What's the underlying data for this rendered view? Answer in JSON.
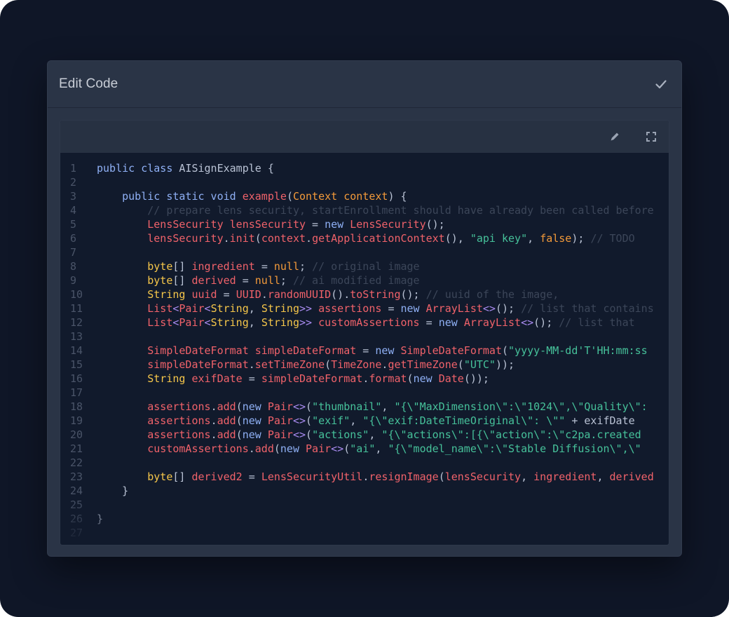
{
  "modal": {
    "title": "Edit Code",
    "confirm_icon": "check-icon"
  },
  "editor": {
    "toolbar": {
      "edit_icon": "pencil-icon",
      "fullscreen_icon": "expand-icon"
    },
    "colors": {
      "keyword": "#8fb0f5",
      "identifier": "#f0626a",
      "type": "#f5c64a",
      "literal": "#f39a3a",
      "string": "#46c19a",
      "comment": "#3c4659",
      "plain": "#b9c2d4"
    },
    "lines": [
      {
        "n": "1",
        "tokens": [
          [
            "kw",
            "public class "
          ],
          [
            "plain",
            "AISignExample {"
          ]
        ]
      },
      {
        "n": "2",
        "tokens": []
      },
      {
        "n": "3",
        "tokens": [
          [
            "kw",
            "    public static void "
          ],
          [
            "red",
            "example"
          ],
          [
            "plain",
            "("
          ],
          [
            "org",
            "Context context"
          ],
          [
            "plain",
            ") {"
          ]
        ]
      },
      {
        "n": "4",
        "tokens": [
          [
            "com",
            "        // prepare lens security, startEnrollment should have already been called before"
          ]
        ]
      },
      {
        "n": "5",
        "tokens": [
          [
            "red",
            "        LensSecurity lensSecurity "
          ],
          [
            "plain",
            "= "
          ],
          [
            "kw",
            "new "
          ],
          [
            "red",
            "LensSecurity"
          ],
          [
            "plain",
            "();"
          ]
        ]
      },
      {
        "n": "6",
        "tokens": [
          [
            "red",
            "        lensSecurity"
          ],
          [
            "plain",
            "."
          ],
          [
            "red",
            "init"
          ],
          [
            "plain",
            "("
          ],
          [
            "red",
            "context"
          ],
          [
            "plain",
            "."
          ],
          [
            "red",
            "getApplicationContext"
          ],
          [
            "plain",
            "(), "
          ],
          [
            "grn",
            "\"api key\""
          ],
          [
            "plain",
            ", "
          ],
          [
            "org",
            "false"
          ],
          [
            "plain",
            "); "
          ],
          [
            "com",
            "// TODO"
          ]
        ]
      },
      {
        "n": "7",
        "tokens": []
      },
      {
        "n": "8",
        "tokens": [
          [
            "yel",
            "        byte"
          ],
          [
            "plain",
            "[] "
          ],
          [
            "red",
            "ingredient "
          ],
          [
            "plain",
            "= "
          ],
          [
            "org",
            "null"
          ],
          [
            "plain",
            "; "
          ],
          [
            "com",
            "// original image"
          ]
        ]
      },
      {
        "n": "9",
        "tokens": [
          [
            "yel",
            "        byte"
          ],
          [
            "plain",
            "[] "
          ],
          [
            "red",
            "derived "
          ],
          [
            "plain",
            "= "
          ],
          [
            "org",
            "null"
          ],
          [
            "plain",
            "; "
          ],
          [
            "com",
            "// ai modified image"
          ]
        ]
      },
      {
        "n": "10",
        "tokens": [
          [
            "yel",
            "        String "
          ],
          [
            "red",
            "uuid "
          ],
          [
            "plain",
            "= "
          ],
          [
            "red",
            "UUID"
          ],
          [
            "plain",
            "."
          ],
          [
            "red",
            "randomUUID"
          ],
          [
            "plain",
            "()."
          ],
          [
            "red",
            "toString"
          ],
          [
            "plain",
            "(); "
          ],
          [
            "com",
            "// uuid of the image,"
          ]
        ]
      },
      {
        "n": "11",
        "tokens": [
          [
            "red",
            "        List"
          ],
          [
            "pur",
            "<"
          ],
          [
            "red",
            "Pair"
          ],
          [
            "pur",
            "<"
          ],
          [
            "yel",
            "String"
          ],
          [
            "plain",
            ", "
          ],
          [
            "yel",
            "String"
          ],
          [
            "pur",
            ">>"
          ],
          [
            "red",
            " assertions "
          ],
          [
            "plain",
            "= "
          ],
          [
            "kw",
            "new "
          ],
          [
            "red",
            "ArrayList"
          ],
          [
            "pur",
            "<>"
          ],
          [
            "plain",
            "(); "
          ],
          [
            "com",
            "// list that contains"
          ]
        ]
      },
      {
        "n": "12",
        "tokens": [
          [
            "red",
            "        List"
          ],
          [
            "pur",
            "<"
          ],
          [
            "red",
            "Pair"
          ],
          [
            "pur",
            "<"
          ],
          [
            "yel",
            "String"
          ],
          [
            "plain",
            ", "
          ],
          [
            "yel",
            "String"
          ],
          [
            "pur",
            ">>"
          ],
          [
            "red",
            " customAssertions "
          ],
          [
            "plain",
            "= "
          ],
          [
            "kw",
            "new "
          ],
          [
            "red",
            "ArrayList"
          ],
          [
            "pur",
            "<>"
          ],
          [
            "plain",
            "(); "
          ],
          [
            "com",
            "// list that"
          ]
        ]
      },
      {
        "n": "13",
        "tokens": []
      },
      {
        "n": "14",
        "tokens": [
          [
            "red",
            "        SimpleDateFormat simpleDateFormat "
          ],
          [
            "plain",
            "= "
          ],
          [
            "kw",
            "new "
          ],
          [
            "red",
            "SimpleDateFormat"
          ],
          [
            "plain",
            "("
          ],
          [
            "grn",
            "\"yyyy-MM-dd'T'HH:mm:ss"
          ]
        ]
      },
      {
        "n": "15",
        "tokens": [
          [
            "red",
            "        simpleDateFormat"
          ],
          [
            "plain",
            "."
          ],
          [
            "red",
            "setTimeZone"
          ],
          [
            "plain",
            "("
          ],
          [
            "red",
            "TimeZone"
          ],
          [
            "plain",
            "."
          ],
          [
            "red",
            "getTimeZone"
          ],
          [
            "plain",
            "("
          ],
          [
            "grn",
            "\"UTC\""
          ],
          [
            "plain",
            "));"
          ]
        ]
      },
      {
        "n": "16",
        "tokens": [
          [
            "yel",
            "        String "
          ],
          [
            "red",
            "exifDate "
          ],
          [
            "plain",
            "= "
          ],
          [
            "red",
            "simpleDateFormat"
          ],
          [
            "plain",
            "."
          ],
          [
            "red",
            "format"
          ],
          [
            "plain",
            "("
          ],
          [
            "kw",
            "new "
          ],
          [
            "red",
            "Date"
          ],
          [
            "plain",
            "());"
          ]
        ]
      },
      {
        "n": "17",
        "tokens": []
      },
      {
        "n": "18",
        "tokens": [
          [
            "red",
            "        assertions"
          ],
          [
            "plain",
            "."
          ],
          [
            "red",
            "add"
          ],
          [
            "plain",
            "("
          ],
          [
            "kw",
            "new "
          ],
          [
            "red",
            "Pair"
          ],
          [
            "pur",
            "<>"
          ],
          [
            "plain",
            "("
          ],
          [
            "grn",
            "\"thumbnail\""
          ],
          [
            "plain",
            ", "
          ],
          [
            "grn",
            "\"{\\\"MaxDimension\\\":\\\"1024\\\",\\\"Quality\\\":"
          ]
        ]
      },
      {
        "n": "19",
        "tokens": [
          [
            "red",
            "        assertions"
          ],
          [
            "plain",
            "."
          ],
          [
            "red",
            "add"
          ],
          [
            "plain",
            "("
          ],
          [
            "kw",
            "new "
          ],
          [
            "red",
            "Pair"
          ],
          [
            "pur",
            "<>"
          ],
          [
            "plain",
            "("
          ],
          [
            "grn",
            "\"exif\""
          ],
          [
            "plain",
            ", "
          ],
          [
            "grn",
            "\"{\\\"exif:DateTimeOriginal\\\": \\\"\""
          ],
          [
            "plain",
            " + exifDate"
          ]
        ]
      },
      {
        "n": "20",
        "tokens": [
          [
            "red",
            "        assertions"
          ],
          [
            "plain",
            "."
          ],
          [
            "red",
            "add"
          ],
          [
            "plain",
            "("
          ],
          [
            "kw",
            "new "
          ],
          [
            "red",
            "Pair"
          ],
          [
            "pur",
            "<>"
          ],
          [
            "plain",
            "("
          ],
          [
            "grn",
            "\"actions\""
          ],
          [
            "plain",
            ", "
          ],
          [
            "grn",
            "\"{\\\"actions\\\":[{\\\"action\\\":\\\"c2pa.created"
          ]
        ]
      },
      {
        "n": "21",
        "tokens": [
          [
            "red",
            "        customAssertions"
          ],
          [
            "plain",
            "."
          ],
          [
            "red",
            "add"
          ],
          [
            "plain",
            "("
          ],
          [
            "kw",
            "new "
          ],
          [
            "red",
            "Pair"
          ],
          [
            "pur",
            "<>"
          ],
          [
            "plain",
            "("
          ],
          [
            "grn",
            "\"ai\""
          ],
          [
            "plain",
            ", "
          ],
          [
            "grn",
            "\"{\\\"model_name\\\":\\\"Stable Diffusion\\\",\\\""
          ]
        ]
      },
      {
        "n": "22",
        "tokens": []
      },
      {
        "n": "23",
        "tokens": [
          [
            "yel",
            "        byte"
          ],
          [
            "plain",
            "[] "
          ],
          [
            "red",
            "derived2 "
          ],
          [
            "plain",
            "= "
          ],
          [
            "red",
            "LensSecurityUtil"
          ],
          [
            "plain",
            "."
          ],
          [
            "red",
            "resignImage"
          ],
          [
            "plain",
            "("
          ],
          [
            "red",
            "lensSecurity"
          ],
          [
            "plain",
            ", "
          ],
          [
            "red",
            "ingredient"
          ],
          [
            "plain",
            ", "
          ],
          [
            "red",
            "derived"
          ]
        ]
      },
      {
        "n": "24",
        "tokens": [
          [
            "plain",
            "    }"
          ]
        ]
      },
      {
        "n": "25",
        "tokens": []
      },
      {
        "n": "26",
        "tokens": [
          [
            "plain",
            "}"
          ]
        ]
      },
      {
        "n": "27",
        "tokens": []
      }
    ]
  }
}
